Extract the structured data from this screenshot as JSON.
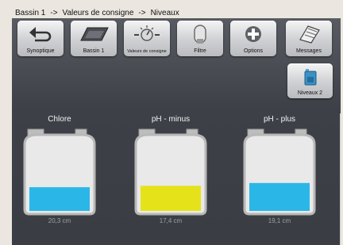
{
  "breadcrumb": {
    "part1": "Bassin 1",
    "sep1": "->",
    "part2": "Valeurs de consigne",
    "sep2": "->",
    "part3": "Niveaux"
  },
  "toolbar": {
    "buttons": [
      {
        "label": "Synoptique",
        "icon": "back-arrow-icon"
      },
      {
        "label": "Bassin 1",
        "icon": "pool-icon"
      },
      {
        "label": "Valeurs de consigne",
        "icon": "dial-icon"
      },
      {
        "label": "Filtre",
        "icon": "filter-icon"
      },
      {
        "label": "Options",
        "icon": "plus-icon"
      },
      {
        "label": "Messages",
        "icon": "notepad-icon"
      }
    ]
  },
  "subnav": {
    "label": "Niveaux 2",
    "icon": "canister-icon"
  },
  "tanks": [
    {
      "name": "Chlore",
      "value": "20,3 cm",
      "level": 0.34,
      "color": "#2bb6e8"
    },
    {
      "name": "pH - minus",
      "value": "17,4 cm",
      "level": 0.36,
      "color": "#e6e21a"
    },
    {
      "name": "pH - plus",
      "value": "19,1 cm",
      "level": 0.4,
      "color": "#2bb6e8"
    }
  ]
}
